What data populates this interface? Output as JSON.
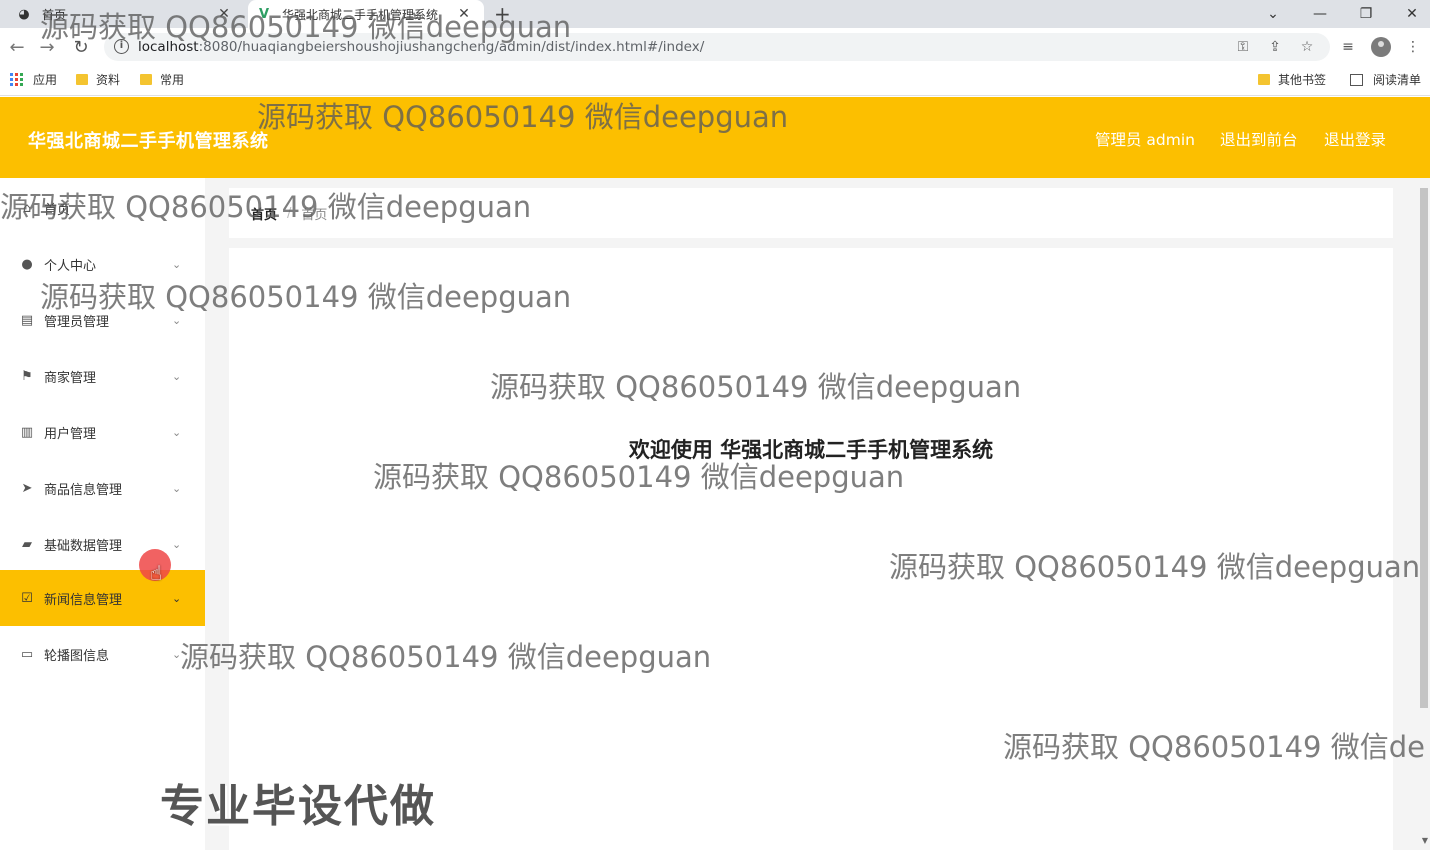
{
  "browser": {
    "tabs": [
      {
        "title": "首页",
        "icon": "vue-logo-icon"
      },
      {
        "title": "华强北商城二手手机管理系统",
        "icon": "vue-logo-icon"
      }
    ],
    "new_tab": "+",
    "url_host": "localhost",
    "url_path": ":8080/huaqiangbeiershoushojiushangcheng/admin/dist/index.html#/index/",
    "bookmarks": [
      "应用",
      "资料",
      "常用"
    ],
    "other_bookmarks": "其他书签",
    "reading_list": "阅读清单"
  },
  "header": {
    "title": "华强北商城二手手机管理系统",
    "user": "管理员 admin",
    "to_frontend": "退出到前台",
    "logout": "退出登录"
  },
  "sidebar": {
    "items": [
      {
        "label": "首页",
        "icon": "home-icon"
      },
      {
        "label": "个人中心",
        "icon": "user-icon"
      },
      {
        "label": "管理员管理",
        "icon": "clipboard-icon"
      },
      {
        "label": "商家管理",
        "icon": "flag-icon"
      },
      {
        "label": "用户管理",
        "icon": "books-icon"
      },
      {
        "label": "商品信息管理",
        "icon": "send-icon"
      },
      {
        "label": "基础数据管理",
        "icon": "briefcase-icon"
      },
      {
        "label": "新闻信息管理",
        "icon": "checklist-icon"
      },
      {
        "label": "轮播图信息",
        "icon": "chat-icon"
      }
    ],
    "active_index": 7
  },
  "breadcrumb": {
    "home": "首页",
    "separator": "/",
    "current": "首页"
  },
  "welcome": "欢迎使用 华强北商城二手手机管理系统",
  "watermark": "源码获取 QQ86050149 微信deepguan",
  "watermark_cut": "源码获取 QQ86050149 微信de",
  "promo": "专业毕设代做",
  "colors": {
    "accent": "#fcbf00"
  }
}
